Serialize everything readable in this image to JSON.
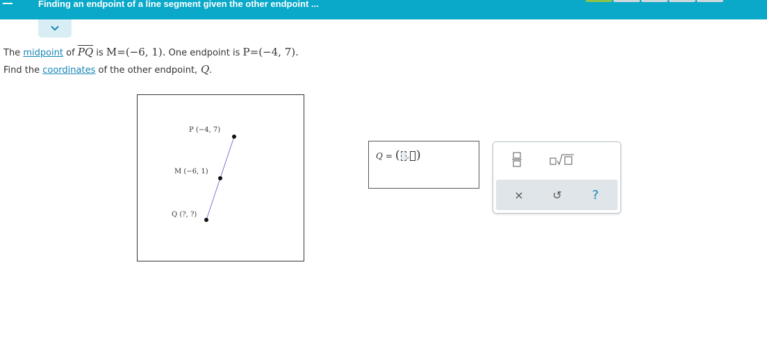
{
  "header": {
    "title": "Finding an endpoint of a line segment given the other endpoint ...",
    "progress_segments_total": 5,
    "progress_segments_done": 1,
    "colors": {
      "bar": "#0aa9c9",
      "progress_done": "#8bc34a",
      "progress_todo": "#cfd8dc"
    }
  },
  "expand_icon": "chevron-down-icon",
  "question": {
    "line1": {
      "text_the": "The",
      "link_midpoint": "midpoint",
      "text_of": "of",
      "segment": "PQ",
      "text_is": "is",
      "m_expr": "M=(−6, 1).",
      "text_one_endpoint": "One endpoint is",
      "p_expr": "P=(−4, 7)."
    },
    "line2": {
      "text_find": "Find the",
      "link_coordinates": "coordinates",
      "text_of_other": "of the other endpoint,",
      "q_var": "Q",
      "period": "."
    }
  },
  "diagram": {
    "labels": {
      "P": "P (−4,  7)",
      "M": "M (−6,  1)",
      "Q": "Q (?, ?)"
    },
    "line_color": "#7b73d6"
  },
  "answer": {
    "var": "Q",
    "equals": "=",
    "open_paren": "(",
    "comma": ",",
    "close_paren": ")"
  },
  "palette": {
    "tools": [
      {
        "name": "fraction-icon"
      },
      {
        "name": "nth-root-icon"
      },
      {
        "name": "clear-icon",
        "glyph": "×"
      },
      {
        "name": "undo-icon",
        "glyph": "↺"
      },
      {
        "name": "help-icon",
        "glyph": "?"
      }
    ],
    "help_color": "#1585b5"
  }
}
